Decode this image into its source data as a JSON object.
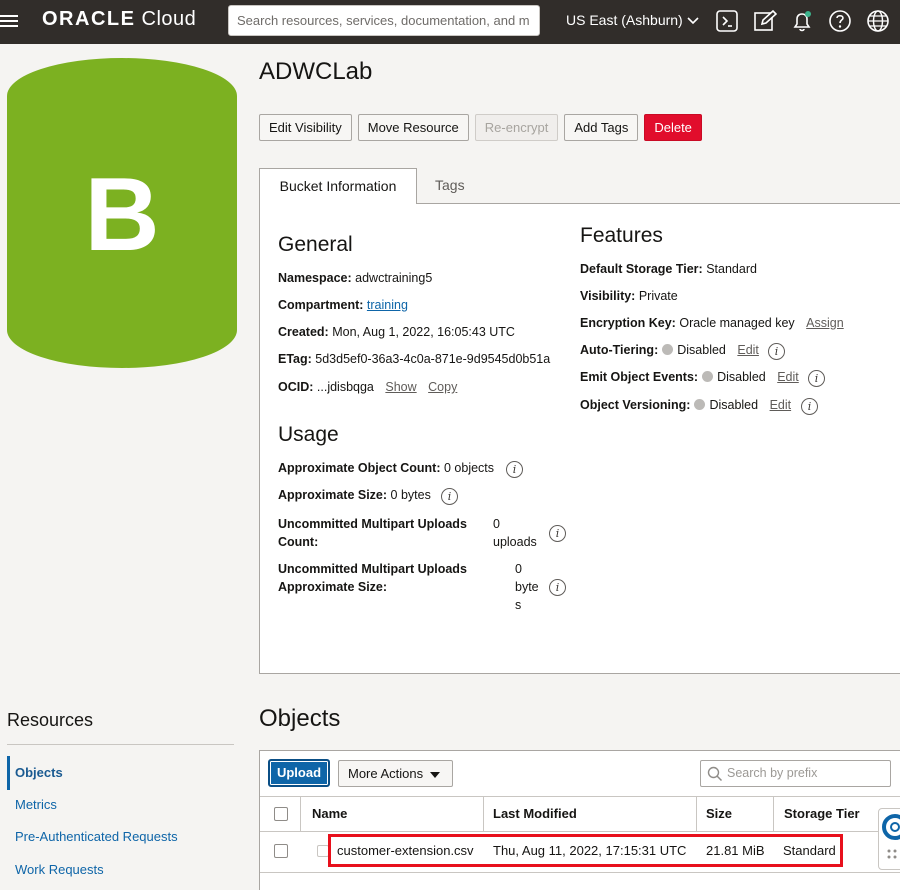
{
  "header": {
    "brand_oracle": "ORACLE",
    "brand_cloud": "Cloud",
    "search_placeholder": "Search resources, services, documentation, and m",
    "region": "US East (Ashburn)"
  },
  "bucket_icon": {
    "letter": "B",
    "color": "#7cb121"
  },
  "page": {
    "title": "ADWCLab",
    "buttons": {
      "edit_visibility": "Edit Visibility",
      "move_resource": "Move Resource",
      "re_encrypt": "Re-encrypt",
      "add_tags": "Add Tags",
      "delete": "Delete"
    }
  },
  "tabs": {
    "active": "Bucket Information",
    "inactive": "Tags"
  },
  "general": {
    "title": "General",
    "namespace_label": "Namespace:",
    "namespace_value": "adwctraining5",
    "compartment_label": "Compartment:",
    "compartment_value": "training",
    "created_label": "Created:",
    "created_value": "Mon, Aug 1, 2022, 16:05:43 UTC",
    "etag_label": "ETag:",
    "etag_value": "5d3d5ef0-36a3-4c0a-871e-9d9545d0b51a",
    "ocid_label": "OCID:",
    "ocid_value": "...jdisbqga",
    "show": "Show",
    "copy": "Copy"
  },
  "features": {
    "title": "Features",
    "storage_tier_label": "Default Storage Tier:",
    "storage_tier_value": "Standard",
    "visibility_label": "Visibility:",
    "visibility_value": "Private",
    "encryption_label": "Encryption Key:",
    "encryption_value": "Oracle managed key",
    "assign": "Assign",
    "auto_tiering_label": "Auto-Tiering:",
    "auto_tiering_value": "Disabled",
    "emit_events_label": "Emit Object Events:",
    "emit_events_value": "Disabled",
    "versioning_label": "Object Versioning:",
    "versioning_value": "Disabled",
    "edit": "Edit"
  },
  "usage": {
    "title": "Usage",
    "object_count_label": "Approximate Object Count:",
    "object_count_value": "0 objects",
    "size_label": "Approximate Size:",
    "size_value": "0 bytes",
    "mp_count_label_1": "Uncommitted Multipart Uploads",
    "mp_count_label_2": "Count:",
    "mp_count_value_1": "0",
    "mp_count_value_2": "uploads",
    "mp_size_label_1": "Uncommitted Multipart Uploads",
    "mp_size_label_2": "Approximate Size:",
    "mp_size_value_1": "0",
    "mp_size_value_2": "byte",
    "mp_size_value_3": "s"
  },
  "resources": {
    "title": "Resources",
    "items": [
      "Objects",
      "Metrics",
      "Pre-Authenticated Requests",
      "Work Requests"
    ]
  },
  "objects": {
    "title": "Objects",
    "upload": "Upload",
    "more_actions": "More Actions",
    "search_placeholder": "Search by prefix",
    "columns": [
      "Name",
      "Last Modified",
      "Size",
      "Storage Tier"
    ],
    "rows": [
      {
        "name": "customer-extension.csv",
        "last_modified": "Thu, Aug 11, 2022, 17:15:31 UTC",
        "size": "21.81 MiB",
        "storage_tier": "Standard"
      }
    ]
  }
}
